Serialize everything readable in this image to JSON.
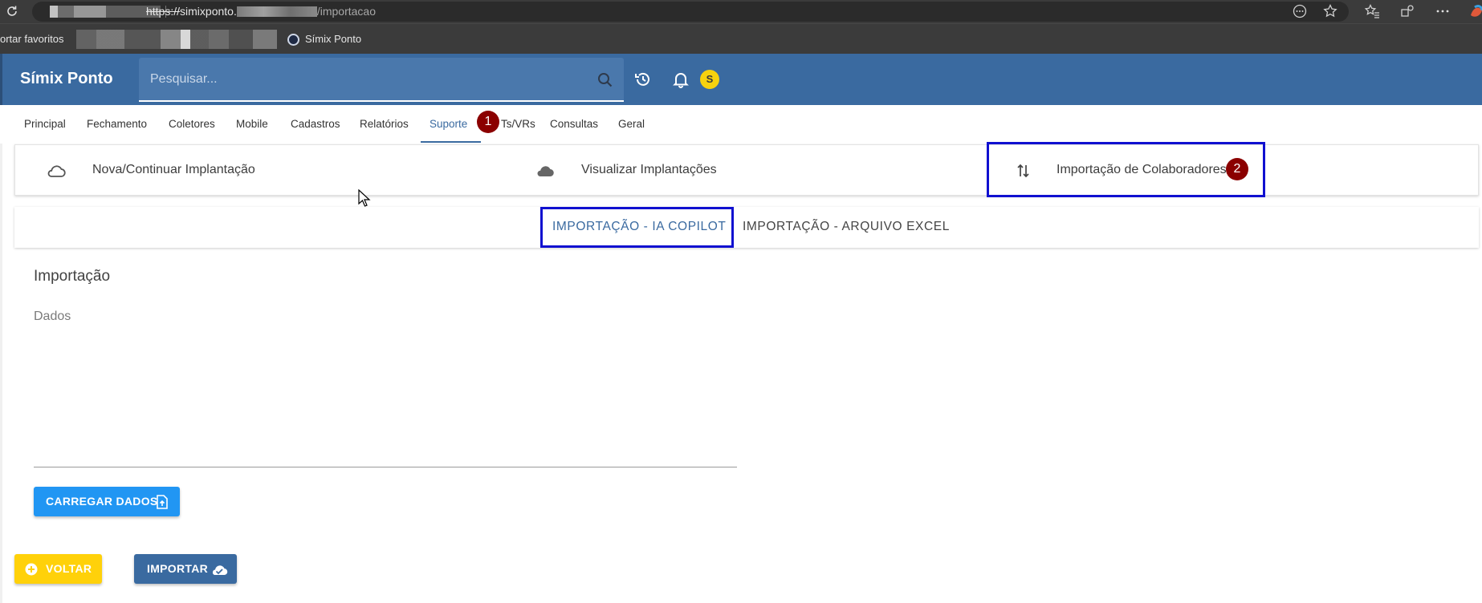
{
  "browser": {
    "url_protocol": "https://",
    "url_host_prefix": "simixponto.",
    "url_path": "/importacao",
    "bookmarks_label": "ortar favoritos",
    "bookmark_item": "Símix Ponto"
  },
  "header": {
    "app_title": "Símix Ponto",
    "search_placeholder": "Pesquisar...",
    "avatar_initial": "S"
  },
  "nav": {
    "items": [
      {
        "label": "Principal"
      },
      {
        "label": "Fechamento"
      },
      {
        "label": "Coletores"
      },
      {
        "label": "Mobile"
      },
      {
        "label": "Cadastros"
      },
      {
        "label": "Relatórios"
      },
      {
        "label": "Suporte"
      },
      {
        "label": "Ts/VRs"
      },
      {
        "label": "Consultas"
      },
      {
        "label": "Geral"
      }
    ],
    "active_index": 6
  },
  "annotations": {
    "badge1": "1",
    "badge2": "2"
  },
  "subnav": {
    "items": [
      {
        "label": "Nova/Continuar Implantação",
        "icon": "cloud-outline-icon"
      },
      {
        "label": "Visualizar Implantações",
        "icon": "cloud-filled-icon"
      },
      {
        "label": "Importação de Colaboradores",
        "icon": "swap-vertical-icon"
      }
    ]
  },
  "tabs": {
    "items": [
      {
        "label": "IMPORTAÇÃO - IA COPILOT"
      },
      {
        "label": "IMPORTAÇÃO - ARQUIVO EXCEL"
      }
    ],
    "active_index": 0
  },
  "content": {
    "section_title": "Importação",
    "textarea_label": "Dados",
    "textarea_value": ""
  },
  "buttons": {
    "load": "CARREGAR DADOS",
    "back": "VOLTAR",
    "import": "IMPORTAR"
  },
  "colors": {
    "header_blue": "#3a6aa0",
    "badge_red": "#8b0000",
    "highlight_blue": "#1010d0",
    "load_button": "#2196f3",
    "back_button": "#ffd10a"
  }
}
